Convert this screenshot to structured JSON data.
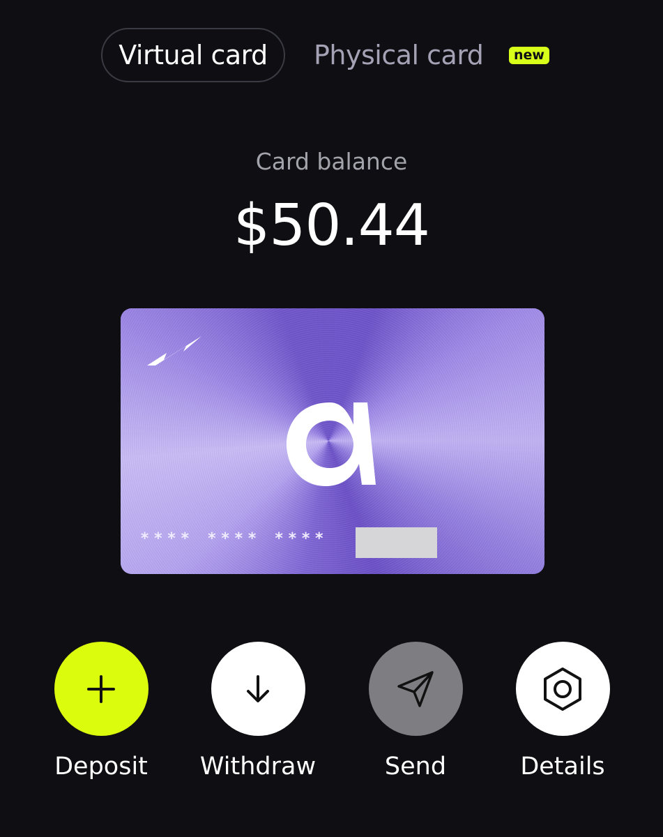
{
  "tabs": {
    "virtual_label": "Virtual card",
    "physical_label": "Physical card",
    "new_badge": "new"
  },
  "balance": {
    "label": "Card balance",
    "value": "$50.44"
  },
  "card": {
    "number_masked": "**** **** ****",
    "brand_symbol": "α",
    "colors": {
      "base": "#7d65d6",
      "highlight": "#c2b4f4"
    }
  },
  "actions": [
    {
      "label": "Deposit",
      "icon": "plus-icon",
      "color": "#dcfc0e"
    },
    {
      "label": "Withdraw",
      "icon": "arrow-down-icon",
      "color": "#ffffff"
    },
    {
      "label": "Send",
      "icon": "send-icon",
      "color": "#7d7d82"
    },
    {
      "label": "Details",
      "icon": "hexagon-nut-icon",
      "color": "#ffffff"
    }
  ],
  "colors": {
    "background": "#0f0f13",
    "accent": "#dcfc0e",
    "muted_text": "#a3a3ab"
  }
}
